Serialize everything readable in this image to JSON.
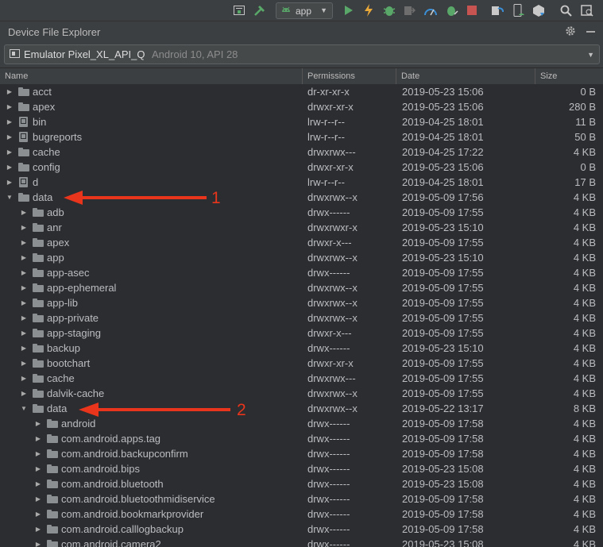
{
  "toolbar": {
    "run_config": "app",
    "icons": [
      "window-icon",
      "hammer-icon",
      "android-icon",
      "run-icon",
      "apply-changes-icon",
      "debug-icon",
      "attach-debugger-icon",
      "profile-icon",
      "debug-bug-icon",
      "stop-icon",
      "sync-icon",
      "device-manager-icon",
      "sdk-manager-icon",
      "search-icon",
      "layout-inspector-icon"
    ]
  },
  "panel": {
    "title": "Device File Explorer"
  },
  "device": {
    "name": "Emulator Pixel_XL_API_Q",
    "meta": "Android 10, API 28"
  },
  "columns": {
    "name": "Name",
    "permissions": "Permissions",
    "date": "Date",
    "size": "Size"
  },
  "rows": [
    {
      "name": "acct",
      "perm": "dr-xr-xr-x",
      "date": "2019-05-23 15:06",
      "size": "0 B",
      "level": 0,
      "type": "folder",
      "expanded": false
    },
    {
      "name": "apex",
      "perm": "drwxr-xr-x",
      "date": "2019-05-23 15:06",
      "size": "280 B",
      "level": 0,
      "type": "folder",
      "expanded": false
    },
    {
      "name": "bin",
      "perm": "lrw-r--r--",
      "date": "2019-04-25 18:01",
      "size": "11 B",
      "level": 0,
      "type": "link",
      "expanded": false
    },
    {
      "name": "bugreports",
      "perm": "lrw-r--r--",
      "date": "2019-04-25 18:01",
      "size": "50 B",
      "level": 0,
      "type": "link",
      "expanded": false
    },
    {
      "name": "cache",
      "perm": "drwxrwx---",
      "date": "2019-04-25 17:22",
      "size": "4 KB",
      "level": 0,
      "type": "folder",
      "expanded": false
    },
    {
      "name": "config",
      "perm": "drwxr-xr-x",
      "date": "2019-05-23 15:06",
      "size": "0 B",
      "level": 0,
      "type": "folder",
      "expanded": false
    },
    {
      "name": "d",
      "perm": "lrw-r--r--",
      "date": "2019-04-25 18:01",
      "size": "17 B",
      "level": 0,
      "type": "link",
      "expanded": false
    },
    {
      "name": "data",
      "perm": "drwxrwx--x",
      "date": "2019-05-09 17:56",
      "size": "4 KB",
      "level": 0,
      "type": "folder",
      "expanded": true
    },
    {
      "name": "adb",
      "perm": "drwx------",
      "date": "2019-05-09 17:55",
      "size": "4 KB",
      "level": 1,
      "type": "folder",
      "expanded": false
    },
    {
      "name": "anr",
      "perm": "drwxrwxr-x",
      "date": "2019-05-23 15:10",
      "size": "4 KB",
      "level": 1,
      "type": "folder",
      "expanded": false
    },
    {
      "name": "apex",
      "perm": "drwxr-x---",
      "date": "2019-05-09 17:55",
      "size": "4 KB",
      "level": 1,
      "type": "folder",
      "expanded": false
    },
    {
      "name": "app",
      "perm": "drwxrwx--x",
      "date": "2019-05-23 15:10",
      "size": "4 KB",
      "level": 1,
      "type": "folder",
      "expanded": false
    },
    {
      "name": "app-asec",
      "perm": "drwx------",
      "date": "2019-05-09 17:55",
      "size": "4 KB",
      "level": 1,
      "type": "folder",
      "expanded": false
    },
    {
      "name": "app-ephemeral",
      "perm": "drwxrwx--x",
      "date": "2019-05-09 17:55",
      "size": "4 KB",
      "level": 1,
      "type": "folder",
      "expanded": false
    },
    {
      "name": "app-lib",
      "perm": "drwxrwx--x",
      "date": "2019-05-09 17:55",
      "size": "4 KB",
      "level": 1,
      "type": "folder",
      "expanded": false
    },
    {
      "name": "app-private",
      "perm": "drwxrwx--x",
      "date": "2019-05-09 17:55",
      "size": "4 KB",
      "level": 1,
      "type": "folder",
      "expanded": false
    },
    {
      "name": "app-staging",
      "perm": "drwxr-x---",
      "date": "2019-05-09 17:55",
      "size": "4 KB",
      "level": 1,
      "type": "folder",
      "expanded": false
    },
    {
      "name": "backup",
      "perm": "drwx------",
      "date": "2019-05-23 15:10",
      "size": "4 KB",
      "level": 1,
      "type": "folder",
      "expanded": false
    },
    {
      "name": "bootchart",
      "perm": "drwxr-xr-x",
      "date": "2019-05-09 17:55",
      "size": "4 KB",
      "level": 1,
      "type": "folder",
      "expanded": false
    },
    {
      "name": "cache",
      "perm": "drwxrwx---",
      "date": "2019-05-09 17:55",
      "size": "4 KB",
      "level": 1,
      "type": "folder",
      "expanded": false
    },
    {
      "name": "dalvik-cache",
      "perm": "drwxrwx--x",
      "date": "2019-05-09 17:55",
      "size": "4 KB",
      "level": 1,
      "type": "folder",
      "expanded": false
    },
    {
      "name": "data",
      "perm": "drwxrwx--x",
      "date": "2019-05-22 13:17",
      "size": "8 KB",
      "level": 1,
      "type": "folder",
      "expanded": true
    },
    {
      "name": "android",
      "perm": "drwx------",
      "date": "2019-05-09 17:58",
      "size": "4 KB",
      "level": 2,
      "type": "folder",
      "expanded": false
    },
    {
      "name": "com.android.apps.tag",
      "perm": "drwx------",
      "date": "2019-05-09 17:58",
      "size": "4 KB",
      "level": 2,
      "type": "folder",
      "expanded": false
    },
    {
      "name": "com.android.backupconfirm",
      "perm": "drwx------",
      "date": "2019-05-09 17:58",
      "size": "4 KB",
      "level": 2,
      "type": "folder",
      "expanded": false
    },
    {
      "name": "com.android.bips",
      "perm": "drwx------",
      "date": "2019-05-23 15:08",
      "size": "4 KB",
      "level": 2,
      "type": "folder",
      "expanded": false
    },
    {
      "name": "com.android.bluetooth",
      "perm": "drwx------",
      "date": "2019-05-23 15:08",
      "size": "4 KB",
      "level": 2,
      "type": "folder",
      "expanded": false
    },
    {
      "name": "com.android.bluetoothmidiservice",
      "perm": "drwx------",
      "date": "2019-05-09 17:58",
      "size": "4 KB",
      "level": 2,
      "type": "folder",
      "expanded": false
    },
    {
      "name": "com.android.bookmarkprovider",
      "perm": "drwx------",
      "date": "2019-05-09 17:58",
      "size": "4 KB",
      "level": 2,
      "type": "folder",
      "expanded": false
    },
    {
      "name": "com.android.calllogbackup",
      "perm": "drwx------",
      "date": "2019-05-09 17:58",
      "size": "4 KB",
      "level": 2,
      "type": "folder",
      "expanded": false
    },
    {
      "name": "com.android.camera2",
      "perm": "drwx------",
      "date": "2019-05-23 15:08",
      "size": "4 KB",
      "level": 2,
      "type": "folder",
      "expanded": false
    }
  ],
  "annotations": [
    {
      "label": "1"
    },
    {
      "label": "2"
    }
  ],
  "colors": {
    "annotation_red": "#e8351c",
    "run_green": "#59a869",
    "stop_red": "#c75450"
  }
}
